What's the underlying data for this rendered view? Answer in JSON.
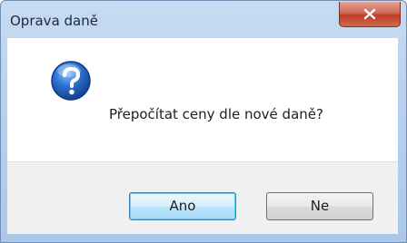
{
  "dialog": {
    "title": "Oprava daně",
    "message": "Přepočítat ceny dle nové daně?",
    "icon": "question-icon"
  },
  "buttons": {
    "yes_label": "Ano",
    "no_label": "Ne"
  },
  "colors": {
    "icon_blue": "#2a6fc9",
    "close_red": "#c9432d",
    "default_button_border": "#3c7fb1"
  }
}
